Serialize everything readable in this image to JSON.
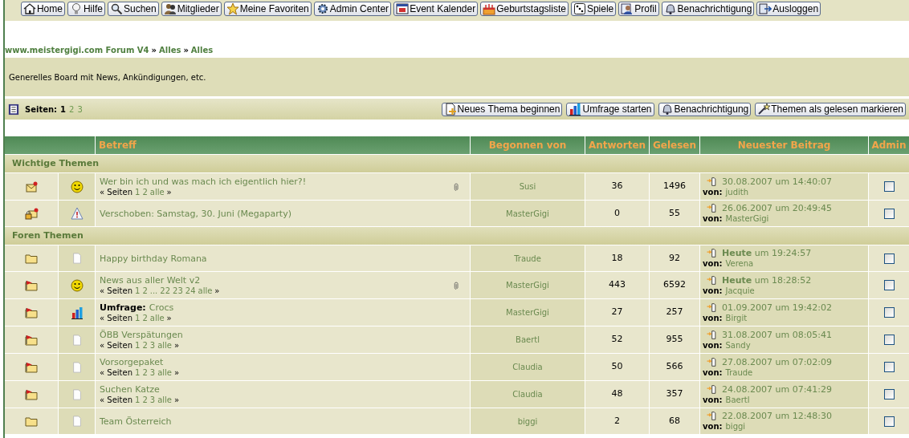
{
  "nav": [
    {
      "label": "Home",
      "kind": "house"
    },
    {
      "label": "Hilfe",
      "kind": "bulb"
    },
    {
      "label": "Suchen",
      "kind": "search"
    },
    {
      "label": "Mitglieder",
      "kind": "people"
    },
    {
      "label": "Meine Favoriten",
      "kind": "star"
    },
    {
      "label": "Admin Center",
      "kind": "gear"
    },
    {
      "label": "Event Kalender",
      "kind": "calendar"
    },
    {
      "label": "Geburtstagsliste",
      "kind": "cake"
    },
    {
      "label": "Spiele",
      "kind": "dice"
    },
    {
      "label": "Profil",
      "kind": "person"
    },
    {
      "label": "Benachrichtigung",
      "kind": "bell"
    },
    {
      "label": "Ausloggen",
      "kind": "exit"
    }
  ],
  "breadcrumb": [
    "www.meistergigi.com Forum V4",
    "Alles",
    "Alles"
  ],
  "breadcrumb_separators": [
    "»",
    "»"
  ],
  "description": "Generelles Board mit News, Ankündigungen, etc.",
  "pagination": {
    "label": "Seiten:",
    "pages": [
      {
        "label": "1",
        "selected": true
      },
      {
        "label": "2",
        "selected": false
      },
      {
        "label": "3",
        "selected": false
      }
    ]
  },
  "actions": [
    {
      "label": "Neues Thema beginnen",
      "kind": "newpage"
    },
    {
      "label": "Umfrage starten",
      "kind": "poll"
    },
    {
      "label": "Benachrichtigung",
      "kind": "bell"
    },
    {
      "label": "Themen als gelesen markieren",
      "kind": "wand"
    }
  ],
  "table": {
    "columns": [
      "Betreff",
      "Begonnen von",
      "Antworten",
      "Gelesen",
      "Neuester Beitrag",
      "Admin"
    ],
    "sections": [
      {
        "title": "Wichtige Themen",
        "rows": [
          {
            "kind": "sticky",
            "topic_icon": {
              "kind": "smiley"
            },
            "title": "Wer bin ich und was mach ich eigentlich hier?!",
            "pages": {
              "open": "« Seiten",
              "links": [
                "1",
                "2",
                "alle"
              ],
              "close": "»"
            },
            "attachment": true,
            "starter": "Susi",
            "replies": "36",
            "views": "1496",
            "last_date": "30.08.2007 um 14:40:07",
            "last_by": {
              "label": "von:",
              "name": "judith"
            },
            "admin_checked": false
          },
          {
            "kind": "sticky_locked",
            "topic_icon": {
              "kind": "warning"
            },
            "title": "Verschoben: Samstag, 30. Juni (Megaparty)",
            "attachment": false,
            "starter": "MasterGigi",
            "replies": "0",
            "views": "55",
            "last_date": "26.06.2007 um 20:49:45",
            "last_by": {
              "label": "von:",
              "name": "MasterGigi"
            },
            "admin_checked": false
          }
        ]
      },
      {
        "title": "Foren Themen",
        "rows": [
          {
            "kind": "folder",
            "topic_icon": {
              "kind": "page"
            },
            "title": "Happy birthday Romana",
            "attachment": false,
            "starter": "Traude",
            "replies": "18",
            "views": "92",
            "last_date": "**Heute** um 19:24:57",
            "last_by": {
              "label": "von:",
              "name": "Verena"
            },
            "admin_checked": false
          },
          {
            "kind": "hot",
            "topic_icon": {
              "kind": "smiley"
            },
            "title": "News aus aller Welt v2",
            "pages": {
              "open": "« Seiten",
              "links": [
                "1",
                "2",
                "...",
                "22",
                "23",
                "24",
                "alle"
              ],
              "close": "»"
            },
            "attachment": true,
            "starter": "MasterGigi",
            "replies": "443",
            "views": "6592",
            "last_date": "**Heute** um 18:28:52",
            "last_by": {
              "label": "von:",
              "name": "Jacquie"
            },
            "admin_checked": false
          },
          {
            "kind": "hot",
            "topic_icon": {
              "kind": "poll"
            },
            "prefix": "Umfrage:",
            "title": "Crocs",
            "pages": {
              "open": "« Seiten",
              "links": [
                "1",
                "2",
                "alle"
              ],
              "close": "»"
            },
            "attachment": false,
            "starter": "MasterGigi",
            "replies": "27",
            "views": "257",
            "last_date": "01.09.2007 um 19:42:02",
            "last_by": {
              "label": "von:",
              "name": "Birgit"
            },
            "admin_checked": false
          },
          {
            "kind": "hot",
            "topic_icon": {
              "kind": "page"
            },
            "title": "ÖBB Verspätungen",
            "pages": {
              "open": "« Seiten",
              "links": [
                "1",
                "2",
                "3",
                "alle"
              ],
              "close": "»"
            },
            "attachment": false,
            "starter": "Baertl",
            "replies": "52",
            "views": "955",
            "last_date": "31.08.2007 um 08:05:41",
            "last_by": {
              "label": "von:",
              "name": "Sandy"
            },
            "admin_checked": false
          },
          {
            "kind": "hot",
            "topic_icon": {
              "kind": "page"
            },
            "title": "Vorsorgepaket",
            "pages": {
              "open": "« Seiten",
              "links": [
                "1",
                "2",
                "3",
                "alle"
              ],
              "close": "»"
            },
            "attachment": false,
            "starter": "Claudia",
            "replies": "50",
            "views": "566",
            "last_date": "27.08.2007 um 07:02:09",
            "last_by": {
              "label": "von:",
              "name": "Traude"
            },
            "admin_checked": false
          },
          {
            "kind": "hot",
            "topic_icon": {
              "kind": "page"
            },
            "title": "Suchen Katze",
            "pages": {
              "open": "« Seiten",
              "links": [
                "1",
                "2",
                "3",
                "alle"
              ],
              "close": "»"
            },
            "attachment": false,
            "starter": "Claudia",
            "replies": "48",
            "views": "357",
            "last_date": "24.08.2007 um 07:41:29",
            "last_by": {
              "label": "von:",
              "name": "Baertl"
            },
            "admin_checked": false
          },
          {
            "kind": "folder",
            "topic_icon": {
              "kind": "page"
            },
            "title": "Team Österreich",
            "attachment": false,
            "starter": "biggi",
            "replies": "2",
            "views": "68",
            "last_date": "22.08.2007 um 12:48:30",
            "last_by": {
              "label": "von:",
              "name": "biggi"
            },
            "admin_checked": false
          }
        ]
      }
    ]
  }
}
